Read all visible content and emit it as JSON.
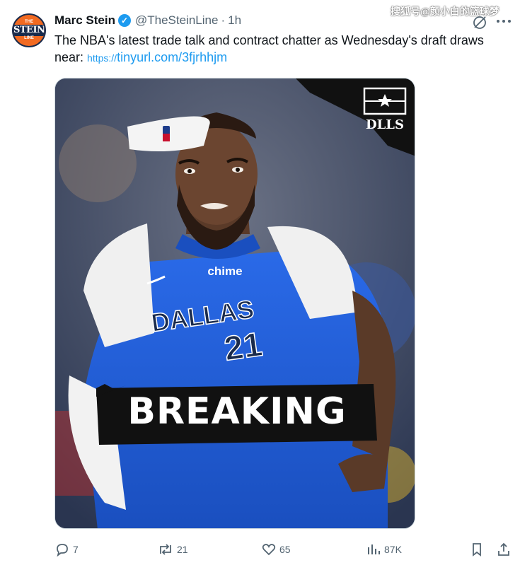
{
  "watermark": "搜狐号@颜小白的篮球梦",
  "author": {
    "name": "Marc Stein",
    "handle": "@TheSteinLine",
    "separator": "·",
    "time": "1h",
    "avatar_text": {
      "top": "THE",
      "middle": "STEIN",
      "bottom": "LINE"
    }
  },
  "tweet": {
    "text": "The NBA's latest trade talk and contract chatter as Wednesday's draft draws near: ",
    "link_prefix": "https://",
    "link_text": "tinyurl.com/3fjrhhjm"
  },
  "media": {
    "logo_text": "DLLS",
    "jersey_brand": "chime",
    "jersey_team": "DALLAS",
    "jersey_number": "21",
    "banner_text": "BREAKING"
  },
  "actions": {
    "replies": "7",
    "retweets": "21",
    "likes": "65",
    "views": "87K"
  },
  "colors": {
    "accent": "#1d9bf0",
    "muted": "#536471",
    "jersey_blue": "#1f5bd6",
    "banner": "#111111"
  }
}
